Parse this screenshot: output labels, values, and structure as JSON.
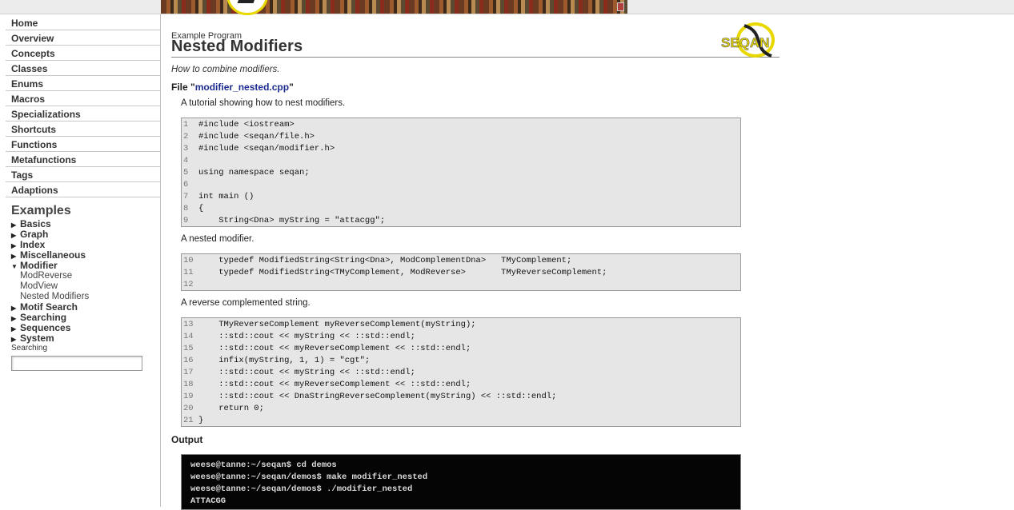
{
  "sidebar": {
    "nav": [
      "Home",
      "Overview",
      "Concepts",
      "Classes",
      "Enums",
      "Macros",
      "Specializations",
      "Shortcuts",
      "Functions",
      "Metafunctions",
      "Tags",
      "Adaptions"
    ],
    "examples_title": "Examples",
    "categories": [
      {
        "label": "Basics",
        "expanded": false
      },
      {
        "label": "Graph",
        "expanded": false
      },
      {
        "label": "Index",
        "expanded": false
      },
      {
        "label": "Miscellaneous",
        "expanded": false
      },
      {
        "label": "Modifier",
        "expanded": true,
        "children": [
          "ModReverse",
          "ModView",
          "Nested Modifiers"
        ]
      },
      {
        "label": "Motif Search",
        "expanded": false
      },
      {
        "label": "Searching",
        "expanded": false
      },
      {
        "label": "Sequences",
        "expanded": false
      },
      {
        "label": "System",
        "expanded": false
      }
    ],
    "search_label": "Searching",
    "search_value": ""
  },
  "page": {
    "kicker": "Example Program",
    "title": "Nested Modifiers",
    "logo_text": "SEQAN",
    "subtitle": "How to combine modifiers.",
    "file_prefix": "File \"",
    "file_name": "modifier_nested.cpp",
    "file_suffix": "\""
  },
  "sections": [
    {
      "text": "A tutorial showing how to nest modifiers.",
      "lines": [
        {
          "n": "1",
          "c": "#include <iostream>"
        },
        {
          "n": "2",
          "c": "#include <seqan/file.h>"
        },
        {
          "n": "3",
          "c": "#include <seqan/modifier.h>"
        },
        {
          "n": "4",
          "c": ""
        },
        {
          "n": "5",
          "c": "using namespace seqan;"
        },
        {
          "n": "6",
          "c": ""
        },
        {
          "n": "7",
          "c": "int main ()"
        },
        {
          "n": "8",
          "c": "{"
        },
        {
          "n": "9",
          "c": "    String<Dna> myString = \"attacgg\";"
        }
      ]
    },
    {
      "text": "A nested modifier.",
      "lines": [
        {
          "n": "10",
          "c": "    typedef ModifiedString<String<Dna>, ModComplementDna>   TMyComplement;"
        },
        {
          "n": "11",
          "c": "    typedef ModifiedString<TMyComplement, ModReverse>       TMyReverseComplement;"
        },
        {
          "n": "12",
          "c": ""
        }
      ]
    },
    {
      "text": "A reverse complemented string.",
      "lines": [
        {
          "n": "13",
          "c": "    TMyReverseComplement myReverseComplement(myString);"
        },
        {
          "n": "14",
          "c": "    ::std::cout << myString << ::std::endl;"
        },
        {
          "n": "15",
          "c": "    ::std::cout << myReverseComplement << ::std::endl;"
        },
        {
          "n": "16",
          "c": "    infix(myString, 1, 1) = \"cgt\";"
        },
        {
          "n": "17",
          "c": "    ::std::cout << myString << ::std::endl;"
        },
        {
          "n": "18",
          "c": "    ::std::cout << myReverseComplement << ::std::endl;"
        },
        {
          "n": "19",
          "c": "    ::std::cout << DnaStringReverseComplement(myString) << ::std::endl;"
        },
        {
          "n": "20",
          "c": "    return 0;"
        },
        {
          "n": "21",
          "c": "}"
        }
      ]
    }
  ],
  "output": {
    "heading": "Output",
    "lines": [
      "weese@tanne:~/seqan$ cd demos",
      "weese@tanne:~/seqan/demos$ make modifier_nested",
      "weese@tanne:~/seqan/demos$ ./modifier_nested",
      "ATTACGG"
    ]
  },
  "colors": {
    "link": "#1b2b8f",
    "code_bg": "#e6e6e6",
    "terminal_bg": "#050505",
    "logo_yellow": "#e8d800"
  }
}
